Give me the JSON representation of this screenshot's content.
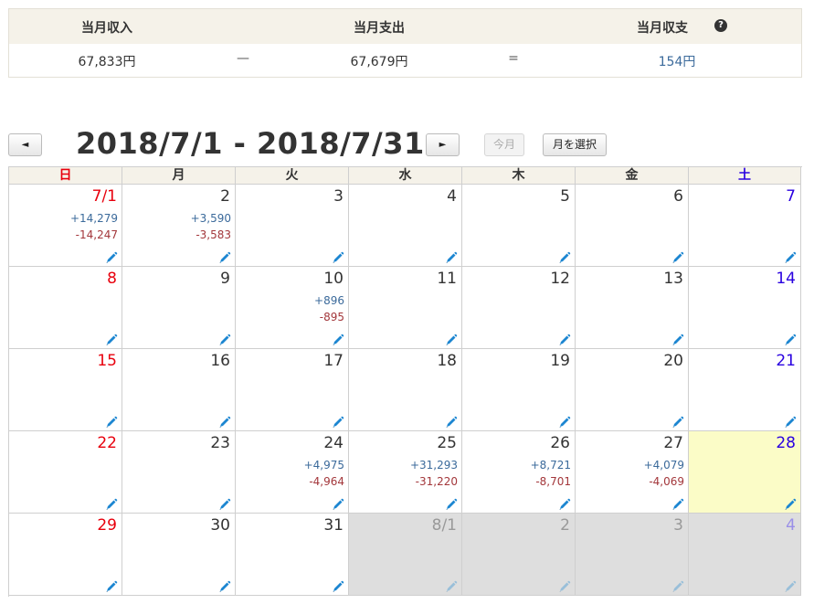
{
  "summary": {
    "income_label": "当月収入",
    "expense_label": "当月支出",
    "balance_label": "当月収支",
    "income_value": "67,833円",
    "minus_sign": "—",
    "expense_value": "67,679円",
    "equals_sign": "=",
    "balance_value": "154円",
    "balance_color": "#3b6a9b",
    "help_icon": "question-circle-icon"
  },
  "toolbar": {
    "prev_label": "◄",
    "range_title": "2018/7/1 - 2018/7/31",
    "next_label": "►",
    "today_label": "今月",
    "select_month_label": "月を選択"
  },
  "calendar": {
    "weekdays": [
      "日",
      "月",
      "火",
      "水",
      "木",
      "金",
      "土"
    ],
    "weekday_colors": [
      "#e8000d",
      "#333333",
      "#333333",
      "#333333",
      "#333333",
      "#333333",
      "#2900e0"
    ],
    "edit_icon": "pencil-icon",
    "weeks": [
      [
        {
          "label": "7/1",
          "income": "+14,279",
          "expense": "-14,247"
        },
        {
          "label": "2",
          "income": "+3,590",
          "expense": "-3,583"
        },
        {
          "label": "3"
        },
        {
          "label": "4"
        },
        {
          "label": "5"
        },
        {
          "label": "6"
        },
        {
          "label": "7"
        }
      ],
      [
        {
          "label": "8"
        },
        {
          "label": "9"
        },
        {
          "label": "10",
          "income": "+896",
          "expense": "-895"
        },
        {
          "label": "11"
        },
        {
          "label": "12"
        },
        {
          "label": "13"
        },
        {
          "label": "14"
        }
      ],
      [
        {
          "label": "15"
        },
        {
          "label": "16"
        },
        {
          "label": "17"
        },
        {
          "label": "18"
        },
        {
          "label": "19"
        },
        {
          "label": "20"
        },
        {
          "label": "21"
        }
      ],
      [
        {
          "label": "22"
        },
        {
          "label": "23"
        },
        {
          "label": "24",
          "income": "+4,975",
          "expense": "-4,964"
        },
        {
          "label": "25",
          "income": "+31,293",
          "expense": "-31,220"
        },
        {
          "label": "26",
          "income": "+8,721",
          "expense": "-8,701"
        },
        {
          "label": "27",
          "income": "+4,079",
          "expense": "-4,069"
        },
        {
          "label": "28",
          "today": true
        }
      ],
      [
        {
          "label": "29"
        },
        {
          "label": "30"
        },
        {
          "label": "31"
        },
        {
          "label": "8/1",
          "other": true
        },
        {
          "label": "2",
          "other": true
        },
        {
          "label": "3",
          "other": true
        },
        {
          "label": "4",
          "other": true
        }
      ]
    ]
  }
}
